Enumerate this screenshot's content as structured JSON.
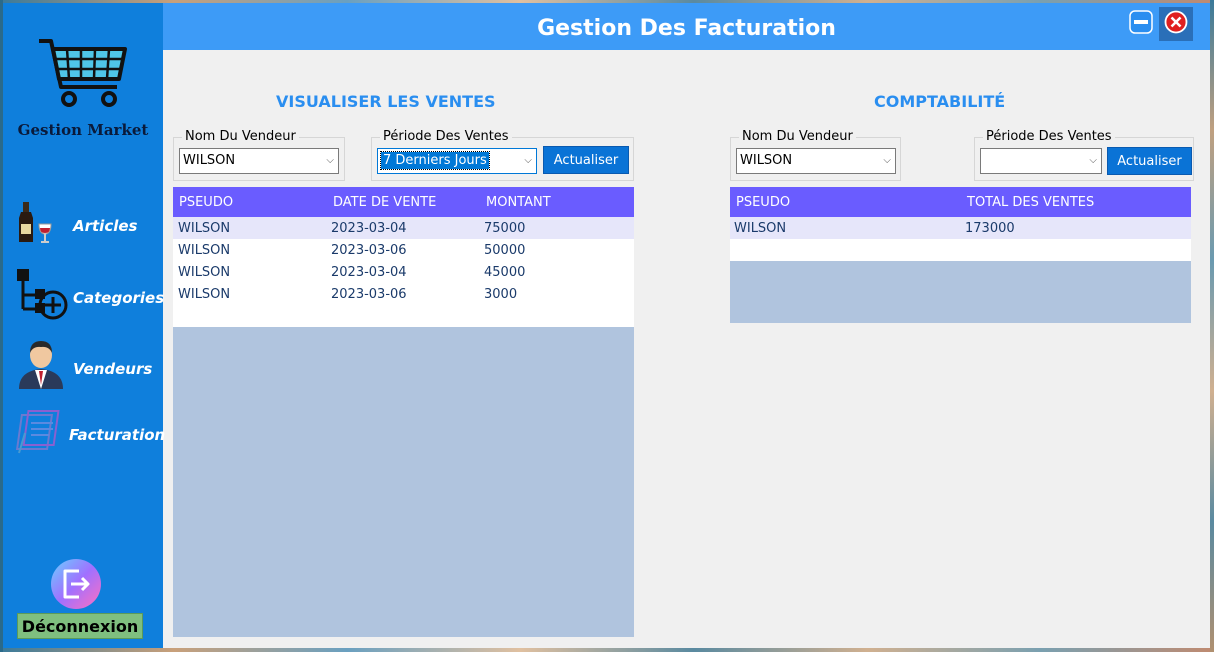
{
  "window": {
    "title": "Gestion Des Facturation"
  },
  "colors": {
    "sidebar": "#0f7fdc",
    "titlebar": "#3d9bf7",
    "grid_header": "#6a5cff",
    "grid_bg": "#b0c4de",
    "section_title": "#2a8ef0",
    "logout": "#7fbf7f"
  },
  "sidebar": {
    "logo_text": "Gestion Market",
    "logo_icon": "shopping-cart-icon",
    "items": [
      {
        "label": "Articles",
        "icon": "wine-bottle-icon"
      },
      {
        "label": "Categories",
        "icon": "category-add-icon"
      },
      {
        "label": "Vendeurs",
        "icon": "businessman-icon"
      },
      {
        "label": "Facturation",
        "icon": "invoice-icon"
      }
    ],
    "logout": {
      "label": "Déconnexion",
      "icon": "logout-icon"
    }
  },
  "ventes": {
    "title": "VISUALISER LES VENTES",
    "vendeur_label": "Nom Du Vendeur",
    "vendeur_value": "WILSON",
    "periode_label": "Période Des Ventes",
    "periode_value": "7 Derniers Jours",
    "refresh_label": "Actualiser",
    "columns": [
      "PSEUDO",
      "DATE DE VENTE",
      "MONTANT"
    ],
    "rows": [
      [
        "WILSON",
        "2023-03-04",
        "75000"
      ],
      [
        "WILSON",
        "2023-03-06",
        "50000"
      ],
      [
        "WILSON",
        "2023-03-04",
        "45000"
      ],
      [
        "WILSON",
        "2023-03-06",
        "3000"
      ]
    ]
  },
  "compta": {
    "title": "COMPTABILITÉ",
    "vendeur_label": "Nom Du Vendeur",
    "vendeur_value": "WILSON",
    "periode_label": "Période Des Ventes",
    "periode_value": "",
    "refresh_label": "Actualiser",
    "columns": [
      "PSEUDO",
      "TOTAL DES VENTES"
    ],
    "rows": [
      [
        "WILSON",
        "173000"
      ]
    ]
  }
}
